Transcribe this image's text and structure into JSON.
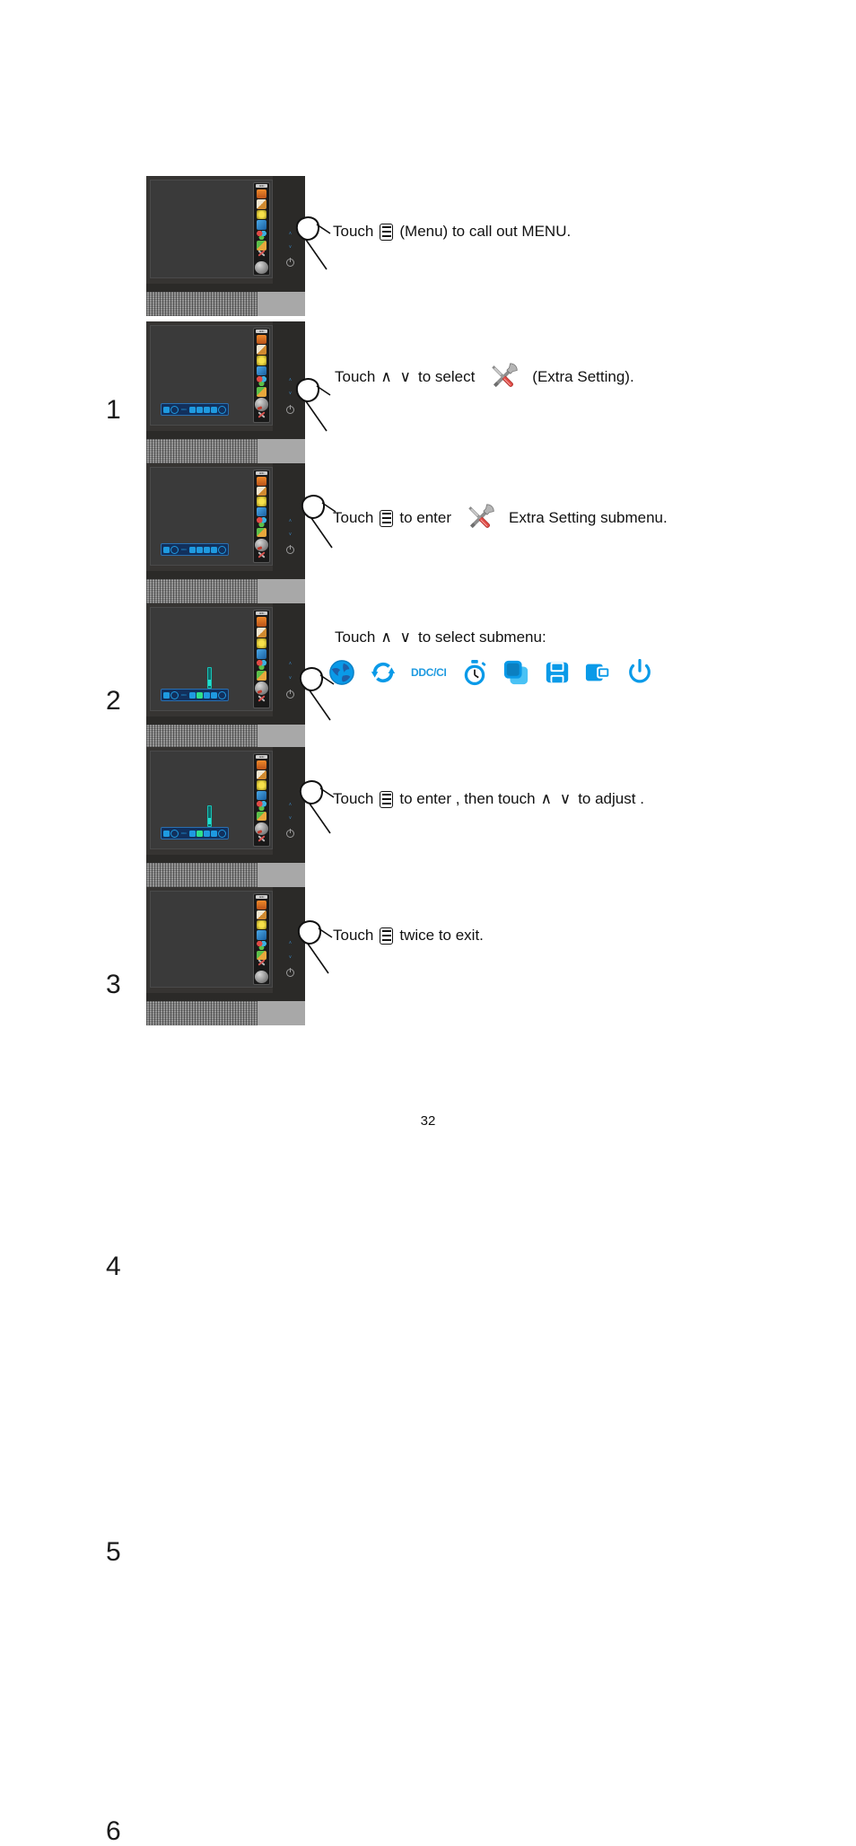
{
  "document": {
    "page_number": "32"
  },
  "steps": [
    {
      "number": "1",
      "instruction_parts": {
        "before": "Touch",
        "after": "(Menu) to  call out MENU."
      },
      "monitor_state": "osd-main-menu-closed",
      "icons": [
        "menu-icon"
      ]
    },
    {
      "number": "2",
      "instruction_parts": {
        "before": "Touch",
        "arrows": "∧ ∨",
        "middle": "to select",
        "after": "(Extra Setting)."
      },
      "monitor_state": "osd-submenu-bar-visible",
      "icons": [
        "up-arrow-icon",
        "down-arrow-icon",
        "extra-setting-tools-icon"
      ]
    },
    {
      "number": "3",
      "instruction_parts": {
        "before": "Touch",
        "middle": "to enter",
        "after": "Extra Setting  submenu."
      },
      "monitor_state": "osd-submenu-bar-visible",
      "icons": [
        "menu-icon",
        "extra-setting-tools-icon"
      ]
    },
    {
      "number": "4",
      "instruction_parts": {
        "before": "Touch",
        "arrows": "∧ ∨",
        "after": "to select submenu:"
      },
      "monitor_state": "osd-submenu-item-selected",
      "icons": [
        "up-arrow-icon",
        "down-arrow-icon"
      ]
    },
    {
      "number": "5",
      "instruction_parts": {
        "before": "Touch",
        "middle": "to enter , then touch",
        "arrows": "∧ ∨",
        "after": "to adjust ."
      },
      "monitor_state": "osd-adjust-slider-visible",
      "icons": [
        "menu-icon",
        "up-arrow-icon",
        "down-arrow-icon"
      ]
    },
    {
      "number": "6",
      "instruction_parts": {
        "before": "Touch",
        "after": "twice to exit."
      },
      "monitor_state": "osd-main-menu-closed",
      "icons": [
        "menu-icon"
      ]
    }
  ],
  "submenu_icons": [
    {
      "name": "language-globe-icon",
      "label": ""
    },
    {
      "name": "reset-refresh-icon",
      "label": ""
    },
    {
      "name": "ddc-ci-icon",
      "label": "DDC/CI"
    },
    {
      "name": "off-timer-stopwatch-icon",
      "label": ""
    },
    {
      "name": "overlay-frames-icon",
      "label": ""
    },
    {
      "name": "image-save-icon",
      "label": ""
    },
    {
      "name": "image-ratio-icon",
      "label": ""
    },
    {
      "name": "power-icon",
      "label": ""
    }
  ],
  "osd_vertical_menu": {
    "logo": "AOC",
    "items": [
      {
        "name": "luminance-icon",
        "color": "#e8731f"
      },
      {
        "name": "image-setup-icon",
        "color": "#d9a03c"
      },
      {
        "name": "color-setup-icon",
        "color": "#e8d24a"
      },
      {
        "name": "picture-boost-icon",
        "color": "#2f7fd0"
      },
      {
        "name": "osd-setup-icon",
        "color": "#3bb0e0"
      },
      {
        "name": "picture-mode-icon",
        "color": "#5cbf4a"
      },
      {
        "name": "extra-setting-icon",
        "color": "#c0392b"
      }
    ]
  },
  "colors": {
    "osd_blue": "#1e9ae0",
    "osd_highlight_green": "#2ee08a",
    "tool_red": "#d9534f",
    "tool_gray": "#9b9b9b",
    "bezel": "#2b2a28",
    "screen": "#3a3a3a"
  }
}
